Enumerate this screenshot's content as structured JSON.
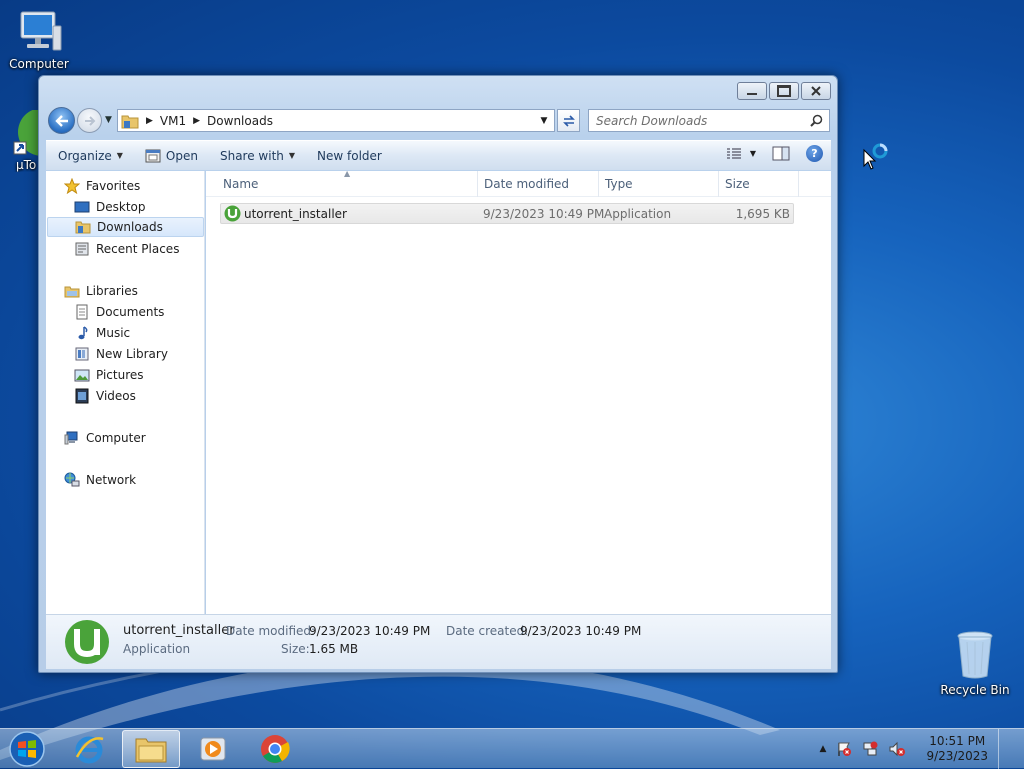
{
  "desktop": {
    "icons": [
      {
        "label": "Computer"
      },
      {
        "label": "µTo"
      },
      {
        "label": "Recycle Bin"
      }
    ]
  },
  "window": {
    "address": {
      "segments": [
        "VM1",
        "Downloads"
      ]
    },
    "search": {
      "placeholder": "Search Downloads"
    },
    "toolbar": {
      "organize": "Organize",
      "open": "Open",
      "share_with": "Share with",
      "new_folder": "New folder"
    },
    "nav": {
      "favorites": "Favorites",
      "favorites_items": [
        "Desktop",
        "Downloads",
        "Recent Places"
      ],
      "libraries": "Libraries",
      "libraries_items": [
        "Documents",
        "Music",
        "New Library",
        "Pictures",
        "Videos"
      ],
      "computer": "Computer",
      "network": "Network",
      "selected": "Downloads"
    },
    "columns": [
      "Name",
      "Date modified",
      "Type",
      "Size"
    ],
    "files": [
      {
        "name": "utorrent_installer",
        "date_modified": "9/23/2023 10:49 PM",
        "type": "Application",
        "size": "1,695 KB"
      }
    ],
    "details": {
      "name": "utorrent_installer",
      "kind": "Application",
      "date_modified_label": "Date modified:",
      "date_modified": "9/23/2023 10:49 PM",
      "size_label": "Size:",
      "size": "1.65 MB",
      "date_created_label": "Date created:",
      "date_created": "9/23/2023 10:49 PM"
    }
  },
  "taskbar": {
    "clock": {
      "time": "10:51 PM",
      "date": "9/23/2023"
    }
  },
  "colors": {
    "accent": "#1f57b0",
    "utorrent_green": "#4aa33a"
  }
}
